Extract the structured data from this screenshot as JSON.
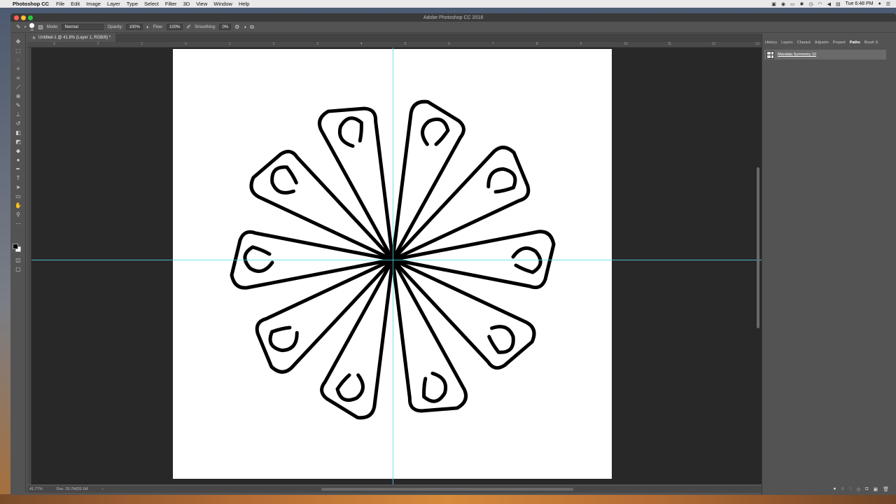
{
  "menubar": {
    "app_name": "Photoshop CC",
    "items": [
      "File",
      "Edit",
      "Image",
      "Layer",
      "Type",
      "Select",
      "Filter",
      "3D",
      "View",
      "Window",
      "Help"
    ],
    "clock": "Tue 6:48 PM"
  },
  "window": {
    "title": "Adobe Photoshop CC 2018"
  },
  "options": {
    "brush_size": "30",
    "mode_label": "Mode:",
    "mode_value": "Normal",
    "opacity_label": "Opacity:",
    "opacity_value": "100%",
    "flow_label": "Flow:",
    "flow_value": "100%",
    "smoothing_label": "Smoothing:",
    "smoothing_value": "0%"
  },
  "document": {
    "tab_label": "Untitled-1 @ 41.8% (Layer 1, RGB/8) *"
  },
  "ruler": {
    "ticks": [
      "3",
      "2",
      "1",
      "0",
      "1",
      "2",
      "3",
      "4",
      "5",
      "6",
      "7",
      "8",
      "9",
      "10",
      "11",
      "12",
      "13"
    ]
  },
  "status": {
    "zoom": "41.77%",
    "doc_size": "Doc: 25.7M/20.1M",
    "arrow": "›"
  },
  "panels": {
    "tabs": [
      "History",
      "Layers",
      "Charact",
      "Adjustm",
      "Propert",
      "Paths",
      "Brush S"
    ],
    "active_tab": "Paths",
    "path_name": "Mandala Symmetry 10"
  },
  "colors": {
    "guide": "#4fd8ee",
    "foreground": "#000000",
    "background": "#ffffff"
  },
  "icons": {
    "tools": [
      "move-icon",
      "marquee-icon",
      "lasso-icon",
      "quick-select-icon",
      "crop-icon",
      "eyedropper-icon",
      "healing-icon",
      "brush-icon",
      "stamp-icon",
      "history-brush-icon",
      "eraser-icon",
      "gradient-icon",
      "blur-icon",
      "dodge-icon",
      "pen-icon",
      "type-icon",
      "path-select-icon",
      "shape-icon",
      "hand-icon",
      "zoom-icon"
    ]
  }
}
